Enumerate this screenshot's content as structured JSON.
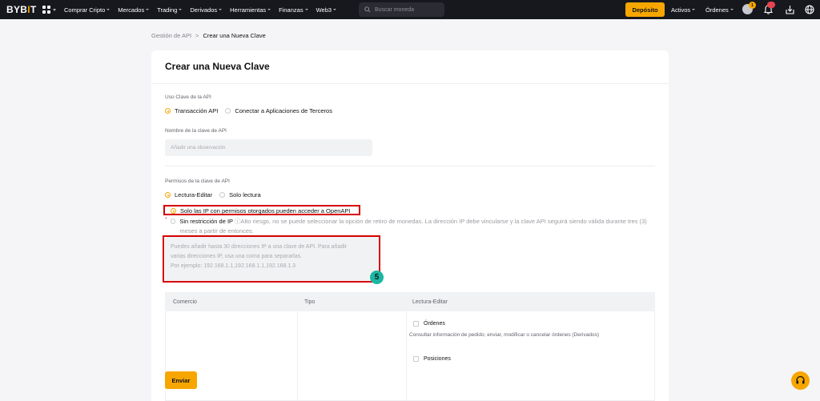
{
  "nav": {
    "logo_a": "BYB",
    "logo_b": "I",
    "logo_c": "T",
    "menu": [
      {
        "label": "Comprar Cripto"
      },
      {
        "label": "Mercados"
      },
      {
        "label": "Trading"
      },
      {
        "label": "Derivados"
      },
      {
        "label": "Herramientas"
      },
      {
        "label": "Finanzas"
      },
      {
        "label": "Web3"
      }
    ],
    "search_placeholder": "Buscar moneda",
    "deposit": "Depósito",
    "assets": "Activos",
    "orders": "Órdenes",
    "avatar_badge": "1",
    "accent": "#f7a600"
  },
  "breadcrumb": {
    "parent": "Gestión de API",
    "separator": ">",
    "current": "Crear una Nueva Clave"
  },
  "card": {
    "title": "Crear una Nueva Clave",
    "usage_label": "Uso Clave de la API",
    "usage_options": [
      "Transacción API",
      "Conectar a Aplicaciones de Terceros"
    ],
    "usage_selected": "Transacción API",
    "name_label": "Nombre de la clave de API",
    "name_placeholder": "Añadir una observación",
    "perm_label": "Permisos de la clave de API",
    "perm_options": [
      "Lectura-Editar",
      "Solo lectura"
    ],
    "perm_selected": "Lectura-Editar",
    "ip_option_1": "Solo las IP con permisos otorgados pueden acceder a OpenAPI",
    "ip_option_2": "Sin restricción de IP",
    "ip_option_2_warning": "ⓘAlto riesgo, no se puede seleccionar la opción de retiro de monedas. La dirección IP debe vincularse y la clave API seguirá siendo válida durante tres (3) meses a partir de entonces.",
    "ip_placeholder_1": "Puedes añadir hasta 30 direcciones IP a una clave de API. Para añadir",
    "ip_placeholder_2": "varias direcciones IP, usa una coma para separarlas.",
    "ip_placeholder_3": "Por ejemplo: 192.168.1.1,192.168.1.1,192.168.1.3",
    "step_number": "5",
    "table": {
      "headers": [
        "Comercio",
        "Tipo",
        "Lectura-Editar"
      ],
      "perm_1": "Órdenes",
      "perm_1_desc": "Consultar información de pedido; enviar, modificar o cancelar órdenes (Derivados)",
      "perm_2": "Posiciones"
    },
    "submit": "Enviar"
  },
  "support_icon": "headset-icon"
}
